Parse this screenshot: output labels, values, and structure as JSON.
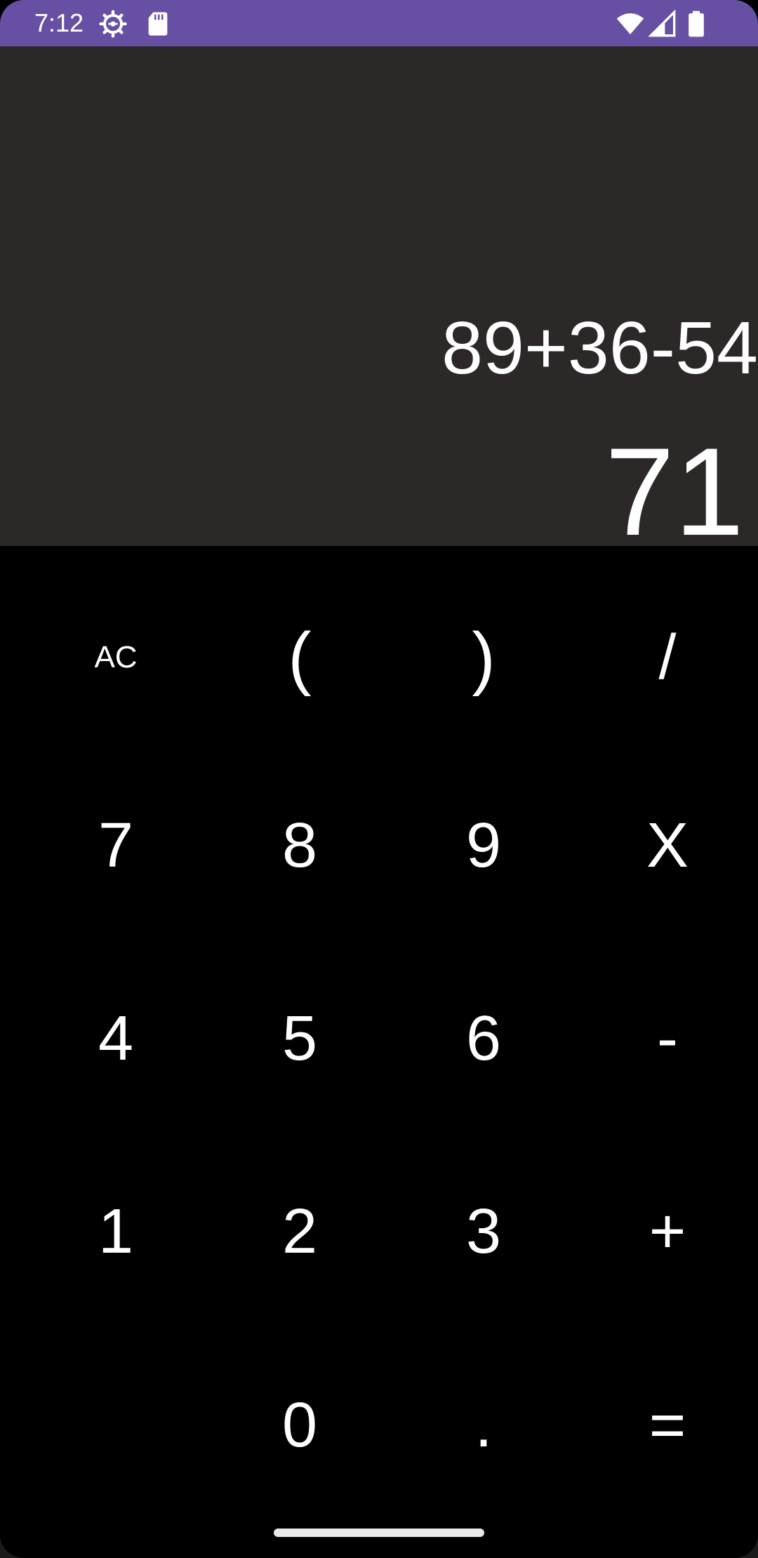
{
  "status_bar": {
    "time": "7:12",
    "color": "#6750a4",
    "icons": [
      "settings-gear-icon",
      "sd-card-icon",
      "wifi-icon",
      "cell-signal-icon",
      "battery-icon"
    ]
  },
  "display": {
    "expression": "89+36-54",
    "result": "71",
    "background": "#2c2828"
  },
  "keypad": {
    "keys": [
      {
        "label": "AC",
        "name": "ac-button"
      },
      {
        "label": "(",
        "name": "open-paren-button"
      },
      {
        "label": ")",
        "name": "close-paren-button"
      },
      {
        "label": "/",
        "name": "divide-button"
      },
      {
        "label": "7",
        "name": "seven-button"
      },
      {
        "label": "8",
        "name": "eight-button"
      },
      {
        "label": "9",
        "name": "nine-button"
      },
      {
        "label": "X",
        "name": "multiply-button"
      },
      {
        "label": "4",
        "name": "four-button"
      },
      {
        "label": "5",
        "name": "five-button"
      },
      {
        "label": "6",
        "name": "six-button"
      },
      {
        "label": "-",
        "name": "minus-button"
      },
      {
        "label": "1",
        "name": "one-button"
      },
      {
        "label": "2",
        "name": "two-button"
      },
      {
        "label": "3",
        "name": "three-button"
      },
      {
        "label": "+",
        "name": "plus-button"
      },
      {
        "label": "0",
        "name": "zero-button"
      },
      {
        "label": ".",
        "name": "decimal-button"
      },
      {
        "label": "=",
        "name": "equals-button"
      }
    ]
  }
}
